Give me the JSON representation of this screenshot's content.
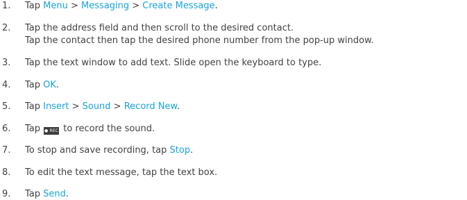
{
  "steps": [
    {
      "num": "1.",
      "segments": [
        {
          "t": "Tap "
        },
        {
          "t": "Menu",
          "kw": true
        },
        {
          "t": " > "
        },
        {
          "t": "Messaging",
          "kw": true
        },
        {
          "t": " > "
        },
        {
          "t": "Create Message",
          "kw": true
        },
        {
          "t": "."
        }
      ]
    },
    {
      "num": "2.",
      "segments": [
        {
          "t": "Tap the address field and then scroll to the desired contact."
        },
        {
          "t": "Tap the contact then tap the desired phone number from the pop-up window.",
          "newline": true
        }
      ]
    },
    {
      "num": "3.",
      "segments": [
        {
          "t": "Tap the text window to add text. Slide open the keyboard to type."
        }
      ]
    },
    {
      "num": "4.",
      "segments": [
        {
          "t": "Tap "
        },
        {
          "t": "OK",
          "kw": true
        },
        {
          "t": "."
        }
      ]
    },
    {
      "num": "5.",
      "segments": [
        {
          "t": "Tap "
        },
        {
          "t": "Insert",
          "kw": true
        },
        {
          "t": " > "
        },
        {
          "t": "Sound",
          "kw": true
        },
        {
          "t": " > "
        },
        {
          "t": "Record New",
          "kw": true
        },
        {
          "t": "."
        }
      ]
    },
    {
      "num": "6.",
      "segments": [
        {
          "t": "Tap "
        },
        {
          "icon": "record-icon",
          "label": "● REC"
        },
        {
          "t": " to record the sound."
        }
      ]
    },
    {
      "num": "7.",
      "segments": [
        {
          "t": "To stop and save recording, tap "
        },
        {
          "t": "Stop",
          "kw": true
        },
        {
          "t": "."
        }
      ]
    },
    {
      "num": "8.",
      "segments": [
        {
          "t": "To edit the text message, tap the text box."
        }
      ]
    },
    {
      "num": "9.",
      "segments": [
        {
          "t": "Tap "
        },
        {
          "t": "Send",
          "kw": true
        },
        {
          "t": "."
        }
      ]
    }
  ],
  "colors": {
    "text": "#414141",
    "keyword": "#1aa3dc",
    "icon_bg": "#3c3c3c"
  }
}
